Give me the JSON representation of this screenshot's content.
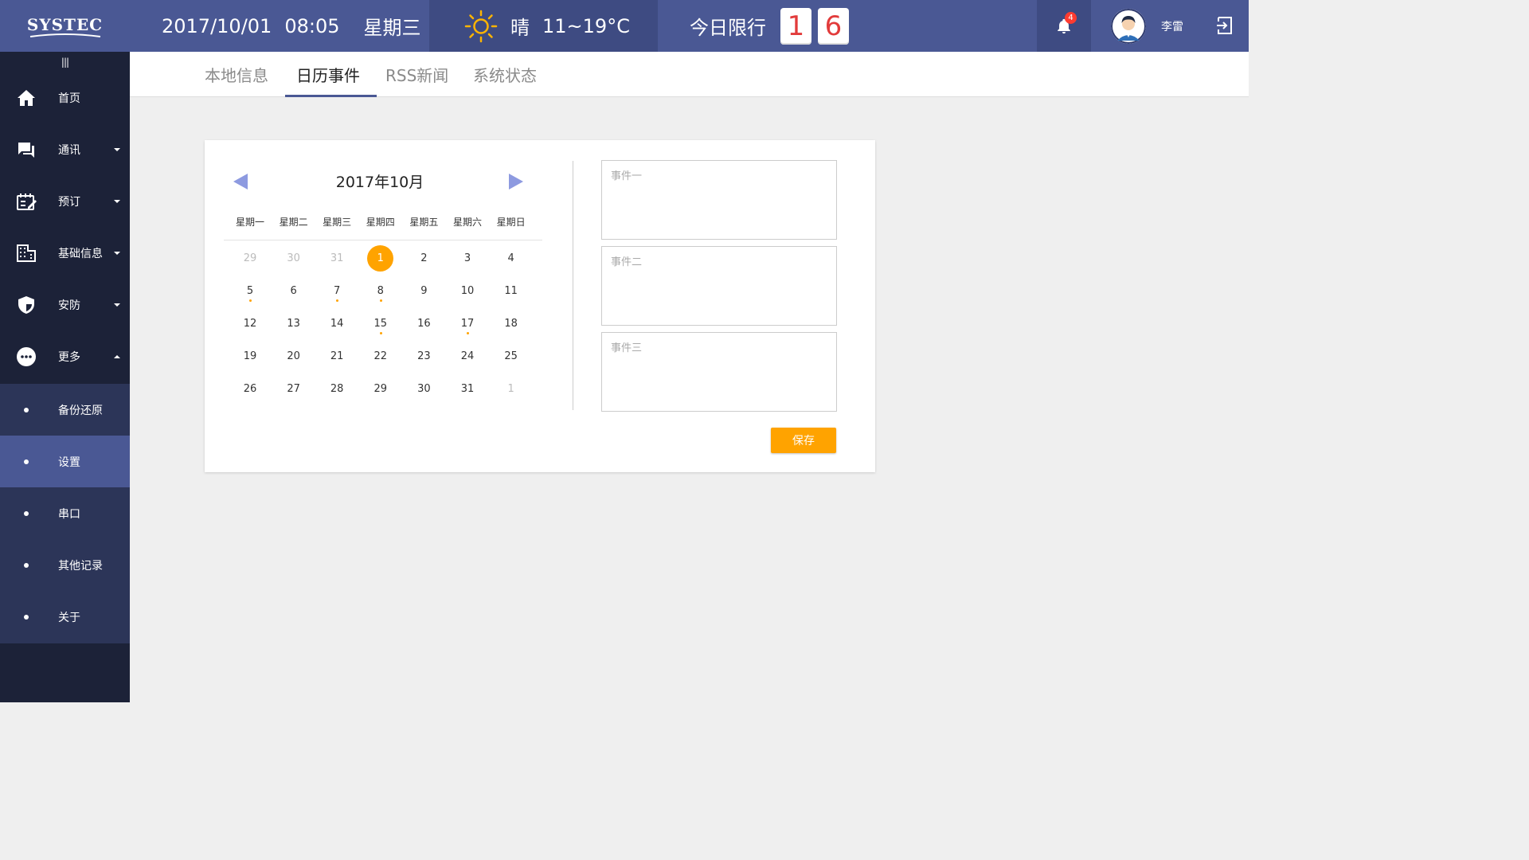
{
  "brand": {
    "logo_text": "SYSTEC"
  },
  "header": {
    "date": "2017/10/01",
    "time": "08:05",
    "weekday": "星期三",
    "weather": {
      "icon": "sun-icon",
      "condition": "晴",
      "temp": "11~19°C"
    },
    "restriction": {
      "label": "今日限行",
      "digits": [
        "1",
        "6"
      ]
    },
    "notifications": {
      "count": "4"
    },
    "user": {
      "name": "李雷"
    }
  },
  "sidebar": {
    "items": [
      {
        "label": "首页",
        "icon": "home-icon"
      },
      {
        "label": "通讯",
        "icon": "chat-icon"
      },
      {
        "label": "预订",
        "icon": "booking-icon"
      },
      {
        "label": "基础信息",
        "icon": "building-icon"
      },
      {
        "label": "安防",
        "icon": "shield-icon"
      },
      {
        "label": "更多",
        "icon": "more-icon"
      }
    ],
    "subitems": [
      {
        "label": "备份还原"
      },
      {
        "label": "设置",
        "active": true
      },
      {
        "label": "串口"
      },
      {
        "label": "其他记录"
      },
      {
        "label": "关于"
      }
    ]
  },
  "tabs": [
    {
      "label": "本地信息"
    },
    {
      "label": "日历事件",
      "active": true
    },
    {
      "label": "RSS新闻"
    },
    {
      "label": "系统状态"
    }
  ],
  "calendar": {
    "title": "2017年10月",
    "weekdays": [
      "星期一",
      "星期二",
      "星期三",
      "星期四",
      "星期五",
      "星期六",
      "星期日"
    ],
    "weeks": [
      [
        "29",
        "30",
        "31",
        "1",
        "2",
        "3",
        "4"
      ],
      [
        "5",
        "6",
        "7",
        "8",
        "9",
        "10",
        "11"
      ],
      [
        "12",
        "13",
        "14",
        "15",
        "16",
        "17",
        "18"
      ],
      [
        "19",
        "20",
        "21",
        "22",
        "23",
        "24",
        "25"
      ],
      [
        "26",
        "27",
        "28",
        "29",
        "30",
        "31",
        "1"
      ]
    ],
    "muted_cells": [
      "0-0",
      "0-1",
      "0-2",
      "4-6"
    ],
    "today_cell": "0-3",
    "event_marks": [
      "1-0",
      "1-2",
      "1-3",
      "2-3",
      "2-5"
    ],
    "accent_color": "#ffa300"
  },
  "events": {
    "placeholders": [
      "事件一",
      "事件二",
      "事件三"
    ],
    "save_label": "保存"
  },
  "colors": {
    "header": "#4a5894",
    "sidebar": "#1c2238",
    "accent": "#ffa300"
  }
}
